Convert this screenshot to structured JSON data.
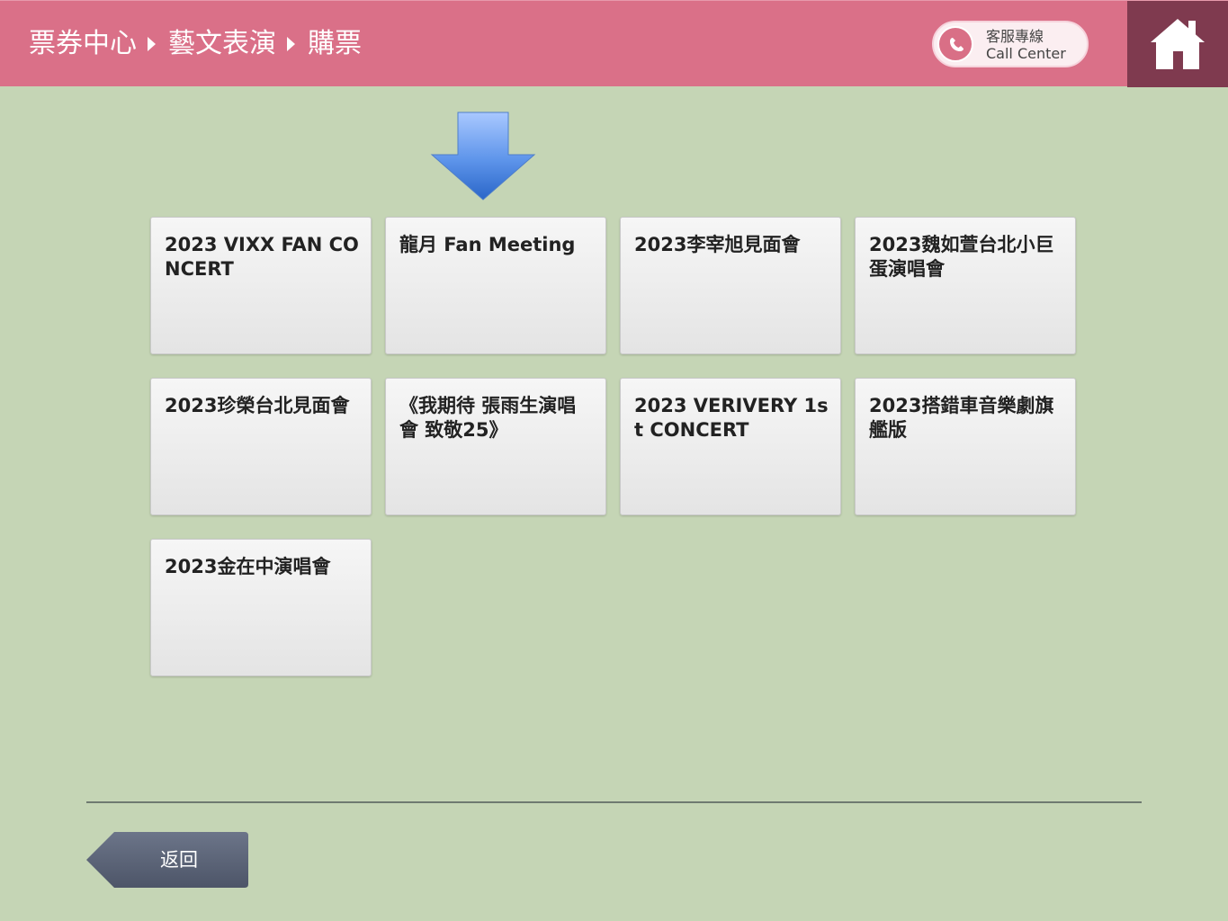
{
  "header": {
    "breadcrumb": [
      "票券中心",
      "藝文表演",
      "購票"
    ],
    "call_center": {
      "line1": "客服專線",
      "line2": "Call Center",
      "icon": "phone-icon"
    },
    "home_icon": "home-icon",
    "colors": {
      "bar": "#da7088",
      "home_bg": "#7f3a4f"
    }
  },
  "guide_arrow_icon": "arrow-down-icon",
  "events": [
    "2023 VIXX FAN CONCERT",
    "龍月 Fan Meeting",
    "2023李宰旭見面會",
    "2023魏如萱台北小巨蛋演唱會",
    "2023珍榮台北見面會",
    "《我期待 張雨生演唱會 致敬25》",
    "2023 VERIVERY 1st CONCERT",
    "2023搭錯車音樂劇旗艦版",
    "2023金在中演唱會"
  ],
  "footer": {
    "back_label": "返回"
  },
  "colors": {
    "background": "#c5d5b5",
    "tile": "#ececec",
    "back_button": "#5b6478"
  }
}
